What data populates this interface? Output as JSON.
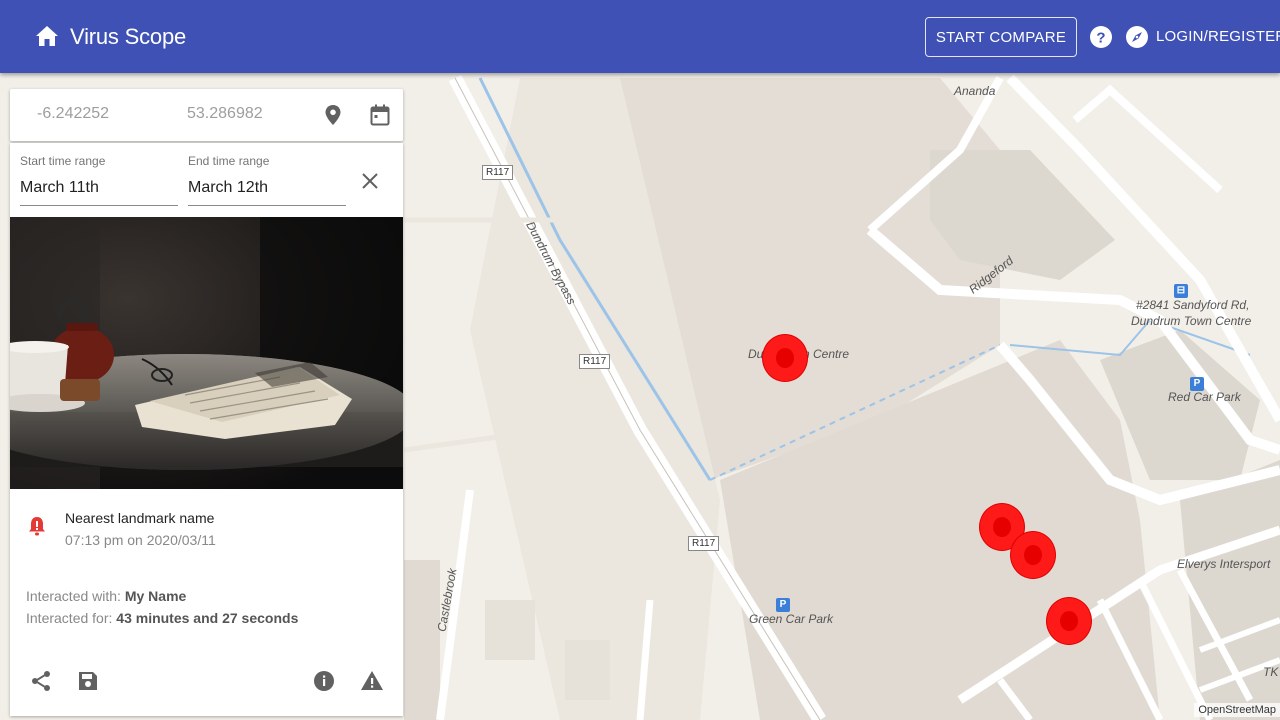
{
  "header": {
    "title": "Virus Scope",
    "compare_label": "START COMPARE",
    "login_label": "LOGIN/REGISTER",
    "bar_color": "#3f51b5"
  },
  "search": {
    "longitude": "-6.242252",
    "latitude": "53.286982"
  },
  "time_range": {
    "start_label": "Start time range",
    "start_value": "March 11th",
    "end_label": "End time range",
    "end_value": "March 12th"
  },
  "detail": {
    "landmark": "Nearest landmark name",
    "timestamp": "07:13 pm on 2020/03/11",
    "interacted_with_label": "Interacted with: ",
    "interacted_with_value": "My Name",
    "interacted_for_label": "Interacted for: ",
    "interacted_for_value": "43 minutes and 27 seconds",
    "alert_color": "#e53935"
  },
  "map": {
    "labels": {
      "ananda": "Ananda",
      "ridgeford": "Ridgeford",
      "sandyford": "#2841 Sandyford Rd,",
      "dundrum_tc": "Dundrum Town Centre",
      "red_car_park": "Red Car Park",
      "dundrum_bypass": "Dundrum Bypass",
      "dundrum_centre_a": "Dun",
      "dundrum_centre_b": "n Centre",
      "green_car_park": "Green Car Park",
      "elverys": "Elverys Intersport",
      "castlebrook": "Castlebrook",
      "tk": "TK",
      "r117": "R117",
      "parking": "P"
    },
    "attribution": "OpenStreetMap",
    "marker_color": "#ff1a1a"
  },
  "icons": [
    "home-icon",
    "help-icon",
    "compass-icon",
    "location-pin-icon",
    "calendar-icon",
    "close-icon",
    "alarm-icon",
    "share-icon",
    "save-icon",
    "info-icon",
    "warning-icon"
  ]
}
